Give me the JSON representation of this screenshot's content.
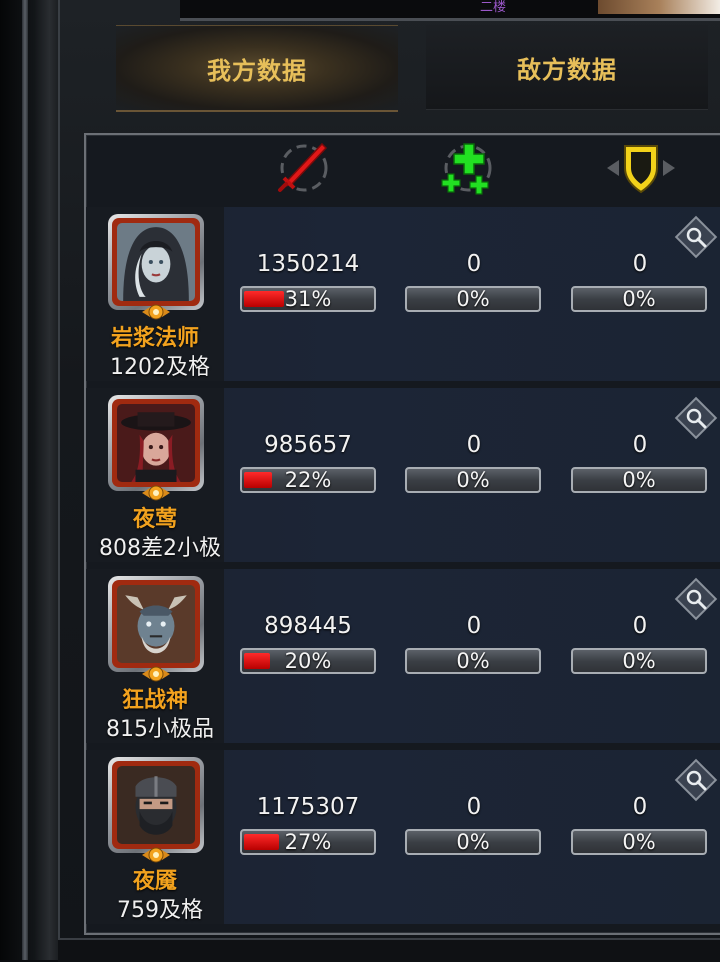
{
  "top_banner": {
    "tag_text": "二楼"
  },
  "tabs": [
    {
      "label": "我方数据",
      "active": true
    },
    {
      "label": "敌方数据",
      "active": false
    }
  ],
  "columns": [
    {
      "icon": "damage-sword-icon",
      "color": "#e02020"
    },
    {
      "icon": "healing-cross-icon",
      "color": "#1fd41f"
    },
    {
      "icon": "defense-shield-icon",
      "color": "#f2d21a"
    }
  ],
  "heroes": [
    {
      "name": "岩浆法师",
      "grade": "1202及格",
      "portrait": "hooded-mage-portrait",
      "damage": "1350214",
      "damage_pct": "31%",
      "damage_ratio": 0.31,
      "heal": "0",
      "heal_pct": "0%",
      "defense": "0",
      "defense_pct": "0%"
    },
    {
      "name": "夜莺",
      "grade": "808差2小极",
      "portrait": "nightingale-portrait",
      "damage": "985657",
      "damage_pct": "22%",
      "damage_ratio": 0.22,
      "heal": "0",
      "heal_pct": "0%",
      "defense": "0",
      "defense_pct": "0%"
    },
    {
      "name": "狂战神",
      "grade": "815小极品",
      "portrait": "berserker-portrait",
      "damage": "898445",
      "damage_pct": "20%",
      "damage_ratio": 0.2,
      "heal": "0",
      "heal_pct": "0%",
      "defense": "0",
      "defense_pct": "0%"
    },
    {
      "name": "夜魇",
      "grade": "759及格",
      "portrait": "masked-ninja-portrait",
      "damage": "1175307",
      "damage_pct": "27%",
      "damage_ratio": 0.27,
      "heal": "0",
      "heal_pct": "0%",
      "defense": "0",
      "defense_pct": "0%"
    }
  ]
}
